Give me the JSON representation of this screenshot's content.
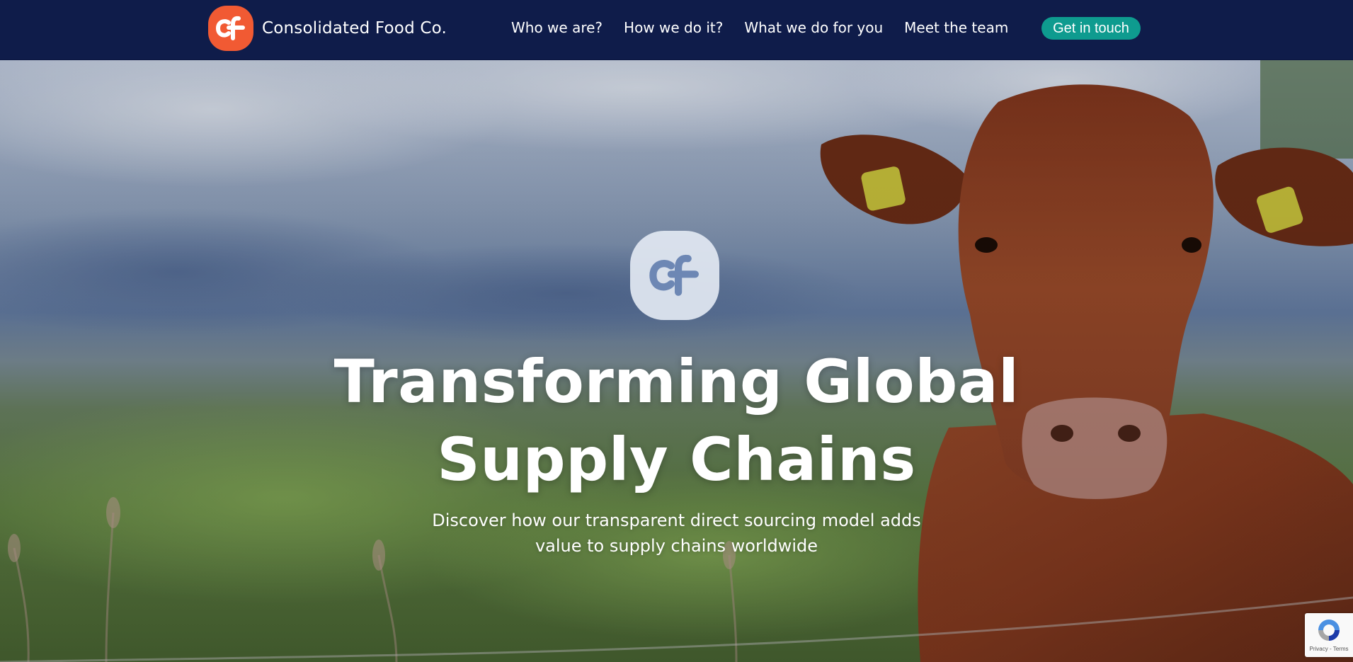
{
  "header": {
    "brand_name": "Consolidated Food Co.",
    "logo_icon": "cf-logo-icon",
    "nav_items": [
      {
        "label": "Who we are?"
      },
      {
        "label": "How we do it?"
      },
      {
        "label": "What we do for you"
      },
      {
        "label": "Meet the team"
      }
    ],
    "cta_label": "Get in touch"
  },
  "hero": {
    "background_image": "cow-in-pasture-photo",
    "logo_icon": "cf-logo-icon",
    "title_line_1": "Transforming Global",
    "title_line_2": "Supply Chains",
    "subtitle_line_1": "Discover how our transparent direct sourcing model adds",
    "subtitle_line_2": "value to supply chains worldwide"
  },
  "recaptcha": {
    "icon": "recaptcha-icon",
    "privacy_label": "Privacy",
    "separator": " - ",
    "terms_label": "Terms"
  },
  "colors": {
    "nav_background": "#0f1c4a",
    "brand_orange": "#f15a33",
    "cta_teal": "#0e9b8f",
    "hero_logo_fill": "#e2e8f2",
    "hero_logo_glyph": "#6d87b4"
  }
}
